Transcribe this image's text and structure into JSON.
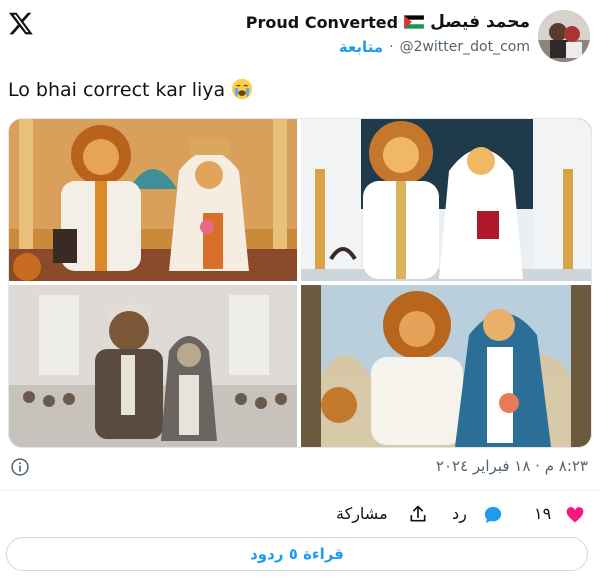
{
  "header": {
    "display_name": "Proud Converted",
    "arabic_name": "محمد فيصل",
    "handle": "@2witter_dot_com",
    "separator": "·",
    "follow_label": "متابعة"
  },
  "tweet": {
    "text": "Lo bhai correct kar liya"
  },
  "meta": {
    "timestamp": "٨:٢٣ م · ١٨ فبراير ٢٠٢٤"
  },
  "actions": {
    "like_count": "١٩",
    "reply_label": "رد",
    "share_label": "مشاركة"
  },
  "read_replies_label": "قراءة ٥ ردود",
  "colors": {
    "accent": "#1d9bf0",
    "like": "#f91880",
    "text": "#0f1419",
    "muted": "#536471"
  },
  "icons": [
    "x-logo-icon",
    "palestine-flag-icon",
    "crying-face-icon",
    "info-icon",
    "heart-icon",
    "reply-icon",
    "share-icon"
  ]
}
